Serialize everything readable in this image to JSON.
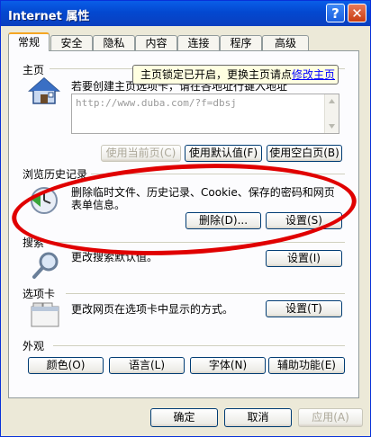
{
  "window": {
    "title": "Internet 属性",
    "help_glyph": "?",
    "close_glyph": "✕"
  },
  "tabs": [
    "常规",
    "安全",
    "隐私",
    "内容",
    "连接",
    "程序",
    "高级"
  ],
  "home": {
    "label": "主页",
    "desc": "若要创建主页选项卡，请在各地址行键入地址",
    "url": "http://www.duba.com/?f=dbsj",
    "tooltip_text": "主页锁定已开启，更换主页请点",
    "tooltip_link": "修改主页",
    "btn_current": "使用当前页(C)",
    "btn_default": "使用默认值(F)",
    "btn_blank": "使用空白页(B)"
  },
  "history": {
    "label": "浏览历史记录",
    "desc_line1": "删除临时文件、历史记录、Cookie、保存的密码和网页",
    "desc_line2": "表单信息。",
    "btn_delete": "删除(D)...",
    "btn_settings": "设置(S)"
  },
  "search": {
    "label": "搜索",
    "desc": "更改搜索默认值。",
    "btn_settings": "设置(I)"
  },
  "tabsec": {
    "label": "选项卡",
    "desc": "更改网页在选项卡中显示的方式。",
    "btn_settings": "设置(T)"
  },
  "appearance": {
    "label": "外观",
    "btn_colors": "颜色(O)",
    "btn_languages": "语言(L)",
    "btn_fonts": "字体(N)",
    "btn_accessibility": "辅助功能(E)"
  },
  "footer": {
    "ok": "确定",
    "cancel": "取消",
    "apply": "应用(A)"
  }
}
